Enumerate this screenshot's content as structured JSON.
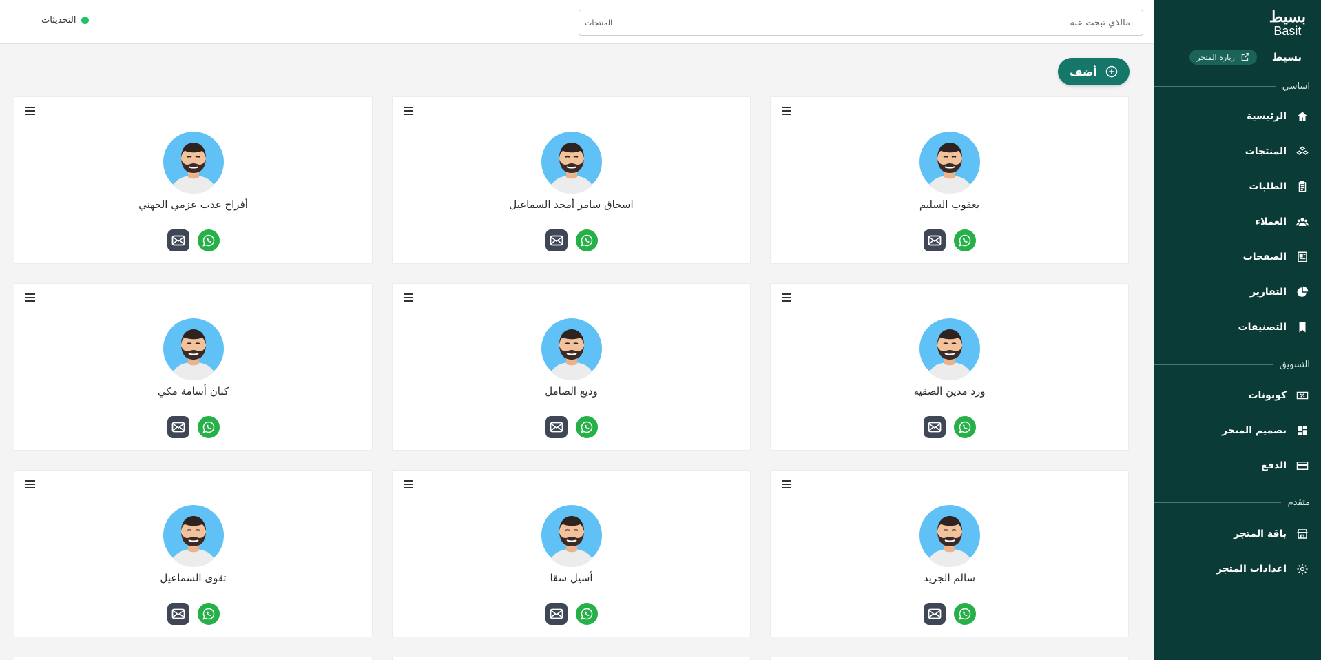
{
  "brand": {
    "logo_ar": "بسيط",
    "logo_en": "Basit",
    "store_name": "بسيط",
    "visit_label": "زيارة المتجر"
  },
  "header": {
    "search_placeholder": "مالذي تبحث عنه",
    "search_scope": "المنتجات",
    "updates_label": "التحديثات",
    "status_color": "#1fc46a"
  },
  "sidebar": {
    "sections": {
      "basic": "اساسي",
      "marketing": "التسويق",
      "advanced": "متقدم"
    },
    "items": [
      {
        "label": "الرئيسية",
        "icon": "home-icon"
      },
      {
        "label": "المنتجات",
        "icon": "products-icon"
      },
      {
        "label": "الطلبات",
        "icon": "orders-icon"
      },
      {
        "label": "العملاء",
        "icon": "users-icon"
      },
      {
        "label": "الصفحات",
        "icon": "pages-icon"
      },
      {
        "label": "التقارير",
        "icon": "reports-icon"
      },
      {
        "label": "التصنيفات",
        "icon": "bookmark-icon"
      },
      {
        "label": "كوبونات",
        "icon": "coupon-icon"
      },
      {
        "label": "تصميم المتجر",
        "icon": "dashboard-icon"
      },
      {
        "label": "الدفع",
        "icon": "card-icon"
      },
      {
        "label": "باقة المتجر",
        "icon": "store-icon"
      },
      {
        "label": "اعدادات المتجر",
        "icon": "gear-icon"
      }
    ]
  },
  "add_button_label": "أضف",
  "customers": [
    "يعقوب السليم",
    "اسحاق سامر أمجد السماعيل",
    "أفراح عدب عزمي الجهني",
    "ورد مدين الصقيه",
    "وديع الصامل",
    "كنان أسامة مكي",
    "سالم الجريد",
    "أسيل سقا",
    "تقوى السماعيل"
  ],
  "colors": {
    "sidebar": "#0b3b36",
    "accent": "#15766a",
    "whatsapp": "#25b048",
    "mail": "#3f4655"
  }
}
